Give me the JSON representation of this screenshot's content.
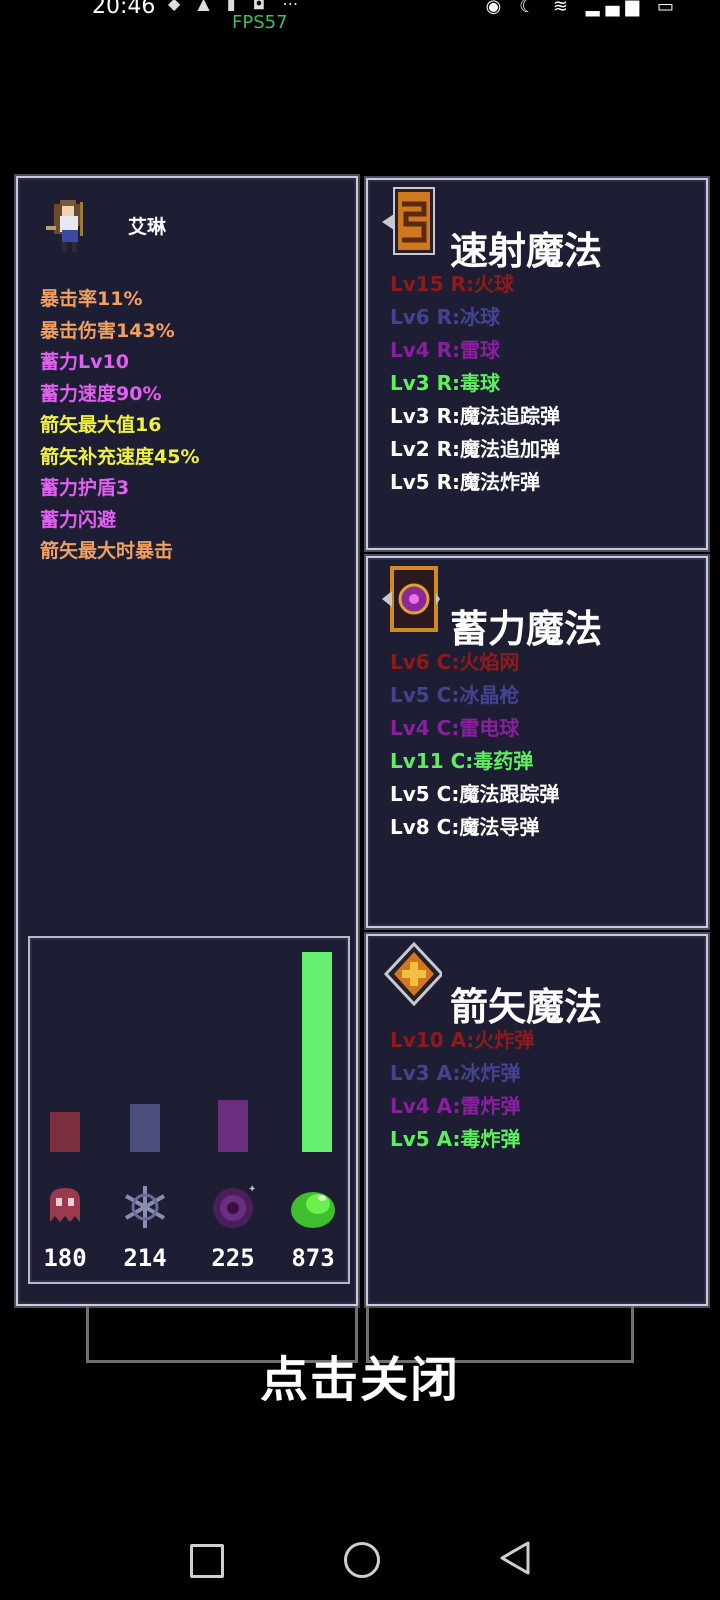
{
  "status_bar": {
    "time": "20:46",
    "fps": "FPS57",
    "battery": "20"
  },
  "character": {
    "name": "艾琳",
    "stats": [
      {
        "text": "暴击率11%",
        "color": "#f0a060"
      },
      {
        "text": "暴击伤害143%",
        "color": "#f0a060"
      },
      {
        "text": "蓄力Lv10",
        "color": "#e060f0"
      },
      {
        "text": "蓄力速度90%",
        "color": "#e060f0"
      },
      {
        "text": "箭矢最大值16",
        "color": "#f0f040"
      },
      {
        "text": "箭矢补充速度45%",
        "color": "#f0f040"
      },
      {
        "text": "蓄力护盾3",
        "color": "#e060f0"
      },
      {
        "text": "蓄力闪避",
        "color": "#e060f0"
      },
      {
        "text": "箭矢最大时暴击",
        "color": "#f0a060"
      }
    ]
  },
  "elements": [
    {
      "name": "fire",
      "value": "180",
      "level": 0.2,
      "color": "#7a2e3e",
      "icon": "ghost-icon"
    },
    {
      "name": "ice",
      "value": "214",
      "level": 0.24,
      "color": "#4c4e7e",
      "icon": "snowflake-icon"
    },
    {
      "name": "thunder",
      "value": "225",
      "level": 0.26,
      "color": "#6a2e7e",
      "icon": "vortex-icon"
    },
    {
      "name": "poison",
      "value": "873",
      "level": 1.0,
      "color": "#66f070",
      "icon": "slime-icon"
    }
  ],
  "rapid_magic": {
    "title": "速射魔法",
    "spells": [
      {
        "text": "Lv15 R:火球",
        "color": "#8e1a1a"
      },
      {
        "text": "Lv6 R:冰球",
        "color": "#43438f"
      },
      {
        "text": "Lv4 R:雷球",
        "color": "#8a1f9f"
      },
      {
        "text": "Lv3 R:毒球",
        "color": "#5cf05c"
      },
      {
        "text": "Lv3 R:魔法追踪弹",
        "color": "#ffffff"
      },
      {
        "text": "Lv2 R:魔法追加弹",
        "color": "#ffffff"
      },
      {
        "text": "Lv5 R:魔法炸弹",
        "color": "#ffffff"
      }
    ]
  },
  "charge_magic": {
    "title": "蓄力魔法",
    "spells": [
      {
        "text": "Lv6 C:火焰网",
        "color": "#8e1a1a"
      },
      {
        "text": "Lv5 C:冰晶枪",
        "color": "#43438f"
      },
      {
        "text": "Lv4 C:雷电球",
        "color": "#8a1f9f"
      },
      {
        "text": "Lv11 C:毒药弹",
        "color": "#5cf05c"
      },
      {
        "text": "Lv5 C:魔法跟踪弹",
        "color": "#ffffff"
      },
      {
        "text": "Lv8 C:魔法导弹",
        "color": "#ffffff"
      }
    ]
  },
  "arrow_magic": {
    "title": "箭矢魔法",
    "spells": [
      {
        "text": "Lv10 A:火炸弹",
        "color": "#8e1a1a"
      },
      {
        "text": "Lv3 A:冰炸弹",
        "color": "#43438f"
      },
      {
        "text": "Lv4 A:雷炸弹",
        "color": "#8a1f9f"
      },
      {
        "text": "Lv5 A:毒炸弹",
        "color": "#5cf05c"
      }
    ]
  },
  "close_label": "点击关闭"
}
